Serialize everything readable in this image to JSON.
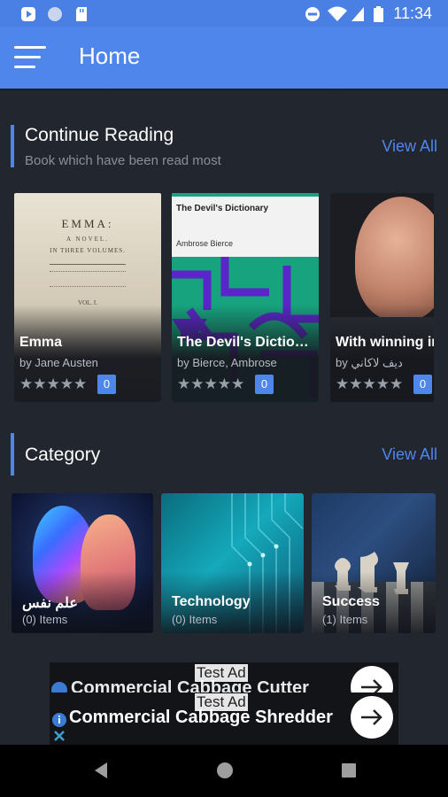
{
  "status_bar": {
    "time": "11:34"
  },
  "app_bar": {
    "title": "Home"
  },
  "continue_reading": {
    "title": "Continue Reading",
    "subtitle": "Book which have been read most",
    "view_all": "View All",
    "books": [
      {
        "title": "Emma",
        "author": "by Jane Austen",
        "stars": "★★★★★",
        "rating_count": "0",
        "cover_lines": [
          "EMMA:",
          "A NOVEL.",
          "IN THREE VOLUMES.",
          "VOL. I."
        ]
      },
      {
        "title": "The Devil's Dictiona...",
        "author": "by Bierce, Ambrose",
        "stars": "★★★★★",
        "rating_count": "0",
        "cover_title": "The Devil's Dictionary",
        "cover_author": "Ambrose Bierce"
      },
      {
        "title": "With winning in mind",
        "author": "by ديف لاكاني",
        "stars": "★★★★★",
        "rating_count": "0"
      }
    ]
  },
  "category": {
    "title": "Category",
    "view_all": "View All",
    "items": [
      {
        "name": "علم نفس",
        "count": "(0) Items"
      },
      {
        "name": "Technology",
        "count": "(0) Items"
      },
      {
        "name": "Success",
        "count": "(1) Items"
      }
    ]
  },
  "ad": {
    "label": "Test Ad",
    "headline_back": "Commercial Cabbage Cutter",
    "headline_front": "Commercial Cabbage Shredder"
  },
  "colors": {
    "accent": "#4f86ec",
    "background": "#22262e",
    "statusbar": "#4a80e3"
  }
}
